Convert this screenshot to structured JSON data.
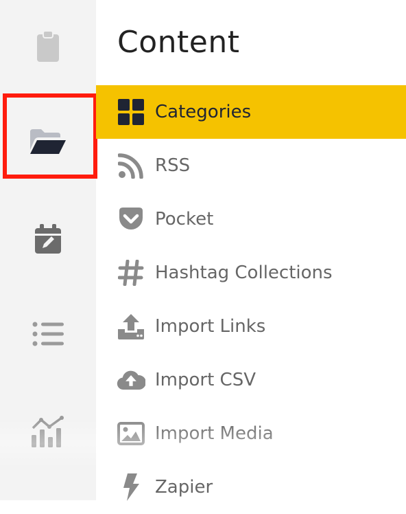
{
  "header": {
    "title": "Content"
  },
  "rail": {
    "items": [
      {
        "icon": "clipboard-icon"
      },
      {
        "icon": "folder-open-icon",
        "selected": true
      },
      {
        "icon": "calendar-edit-icon"
      },
      {
        "icon": "list-icon"
      },
      {
        "icon": "analytics-icon"
      }
    ],
    "highlight_color": "#ff1c0d"
  },
  "menu": {
    "items": [
      {
        "label": "Categories",
        "icon": "grid-icon",
        "active": true
      },
      {
        "label": "RSS",
        "icon": "rss-icon"
      },
      {
        "label": "Pocket",
        "icon": "pocket-icon"
      },
      {
        "label": "Hashtag Collections",
        "icon": "hashtag-icon"
      },
      {
        "label": "Import Links",
        "icon": "upload-icon"
      },
      {
        "label": "Import CSV",
        "icon": "cloud-upload-icon"
      },
      {
        "label": "Import Media",
        "icon": "image-icon"
      },
      {
        "label": "Zapier",
        "icon": "bolt-icon"
      }
    ],
    "active_color": "#f5c200"
  }
}
